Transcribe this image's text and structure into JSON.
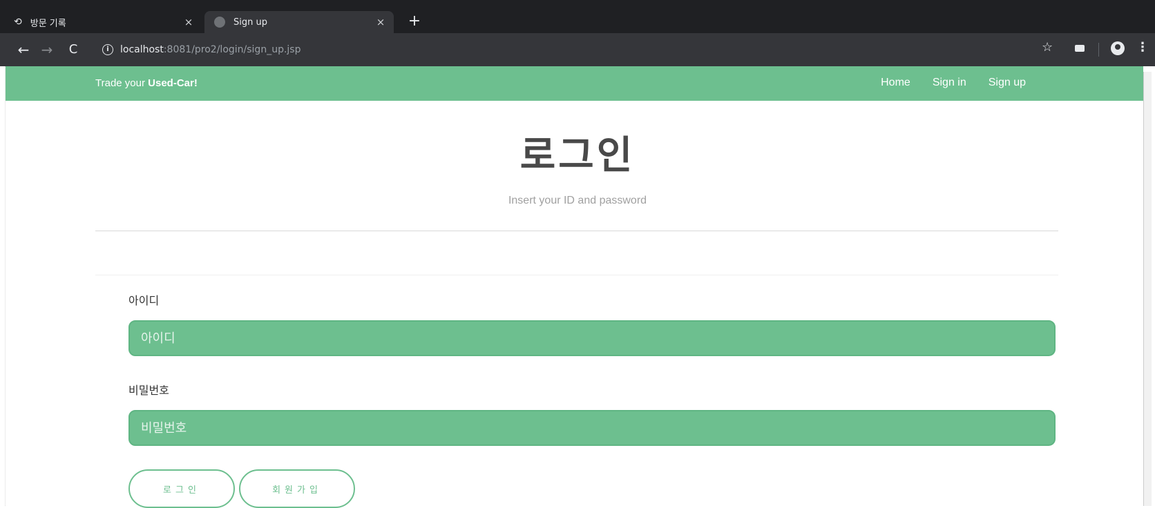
{
  "browser": {
    "tabs": [
      {
        "title": "방문 기록",
        "icon": "history-icon",
        "close": "×"
      },
      {
        "title": "Sign up",
        "icon": "globe-icon",
        "close": "×"
      }
    ],
    "new_tab": "+",
    "nav": {
      "back": "←",
      "forward": "→",
      "reload": "C"
    },
    "url_host": "localhost",
    "url_path": ":8081/pro2/login/sign_up.jsp",
    "icons": {
      "info": "i",
      "bookmark": "☆",
      "menu": "⋮"
    }
  },
  "site": {
    "brand_prefix": "Trade your ",
    "brand_bold": "Used-Car!",
    "nav_links": [
      "Home",
      "Sign in",
      "Sign up"
    ],
    "accent_color": "#6dbf8f"
  },
  "main": {
    "title": "로그인",
    "subtitle": "Insert your ID and password",
    "id_label": "아이디",
    "id_placeholder": "아이디",
    "password_label": "비밀번호",
    "password_placeholder": "비밀번호",
    "login_button": "로그인",
    "signup_button": "회원가입"
  }
}
